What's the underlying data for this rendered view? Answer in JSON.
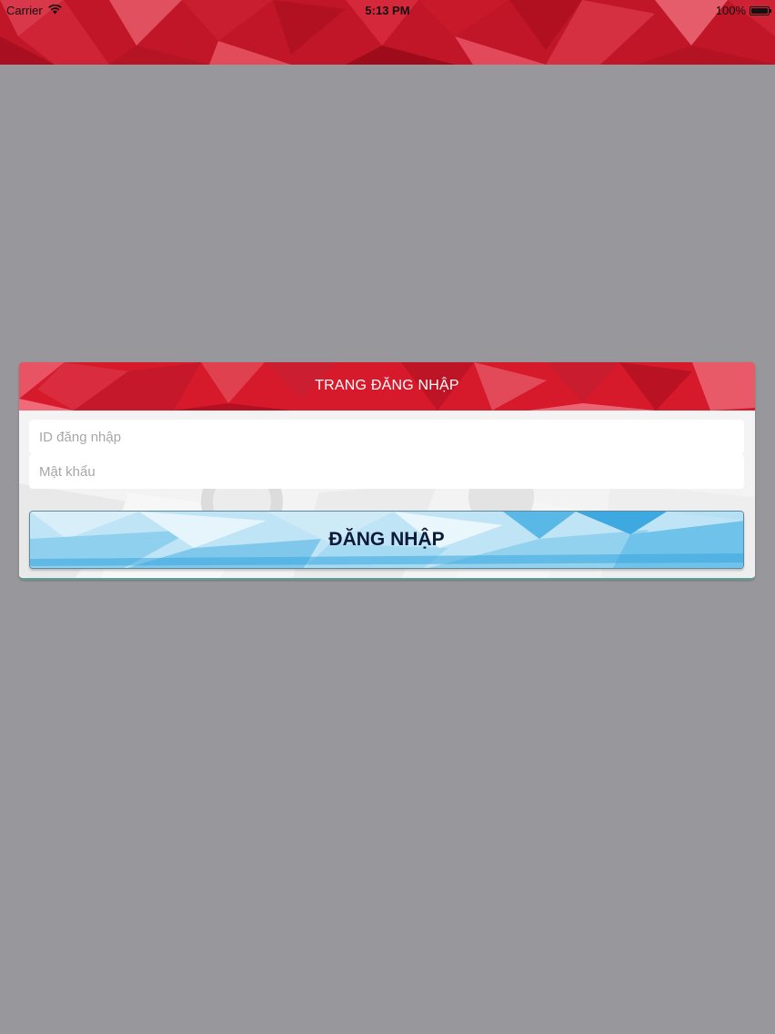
{
  "status_bar": {
    "carrier": "Carrier",
    "time": "5:13 PM",
    "battery": "100%",
    "battery_level": 1.0,
    "wifi_icon": "wifi-icon",
    "battery_icon": "battery-icon"
  },
  "colors": {
    "background": "#98979b",
    "brand_red": "#d6192b",
    "button_blue": "#5ab8e6"
  },
  "login": {
    "title": "TRANG ĐĂNG NHẬP",
    "id_placeholder": "ID đăng nhập",
    "password_placeholder": "Mật khẩu",
    "submit_label": "ĐĂNG NHẬP"
  }
}
